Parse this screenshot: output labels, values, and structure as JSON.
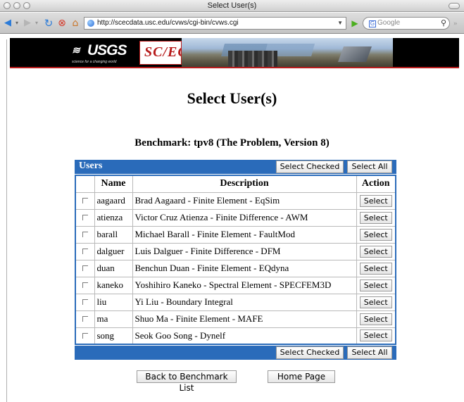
{
  "window": {
    "title": "Select User(s)"
  },
  "browser": {
    "url": "http://scecdata.usc.edu/cvws/cgi-bin/cvws.cgi",
    "search_placeholder": "Google"
  },
  "banner": {
    "usgs_text": "USGS",
    "usgs_tagline": "science for a changing world",
    "scec_text": "SC/EC"
  },
  "page": {
    "heading": "Select User(s)",
    "benchmark": "Benchmark: tpv8 (The Problem, Version 8)"
  },
  "users_table": {
    "bar_label": "Users",
    "select_checked_label": "Select Checked",
    "select_all_label": "Select All",
    "columns": [
      "",
      "Name",
      "Description",
      "Action"
    ],
    "action_label": "Select",
    "rows": [
      {
        "name": "aagaard",
        "description": "Brad Aagaard - Finite Element - EqSim"
      },
      {
        "name": "atienza",
        "description": "Victor Cruz Atienza - Finite Difference - AWM"
      },
      {
        "name": "barall",
        "description": "Michael Barall - Finite Element - FaultMod"
      },
      {
        "name": "dalguer",
        "description": "Luis Dalguer - Finite Difference - DFM"
      },
      {
        "name": "duan",
        "description": "Benchun Duan - Finite Element - EQdyna"
      },
      {
        "name": "kaneko",
        "description": "Yoshihiro Kaneko - Spectral Element - SPECFEM3D"
      },
      {
        "name": "liu",
        "description": "Yi Liu - Boundary Integral"
      },
      {
        "name": "ma",
        "description": "Shuo Ma - Finite Element - MAFE"
      },
      {
        "name": "song",
        "description": "Seok Goo Song - Dynelf"
      }
    ]
  },
  "footer": {
    "back_label": "Back to Benchmark List",
    "home_label": "Home Page"
  },
  "colors": {
    "bar_blue": "#2a6bba",
    "banner_red": "#b71c1c"
  }
}
